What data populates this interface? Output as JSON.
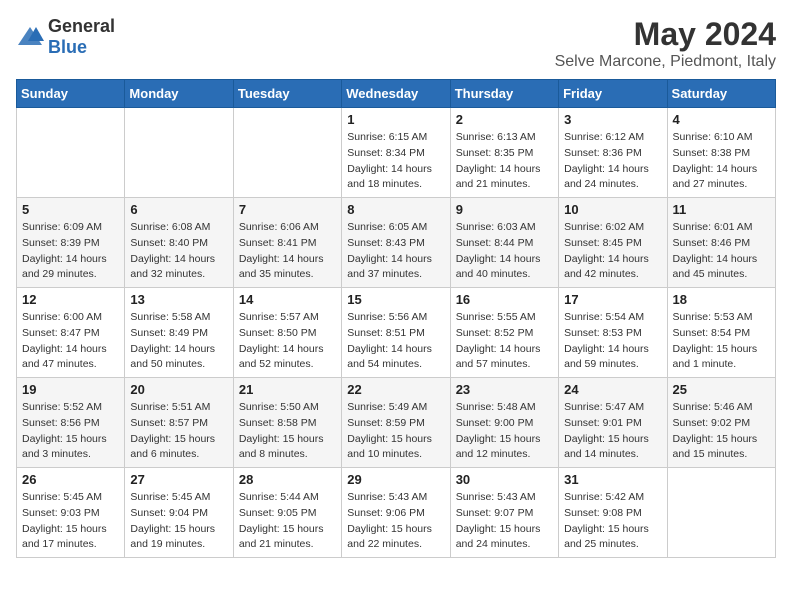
{
  "header": {
    "logo_general": "General",
    "logo_blue": "Blue",
    "month_title": "May 2024",
    "subtitle": "Selve Marcone, Piedmont, Italy"
  },
  "weekdays": [
    "Sunday",
    "Monday",
    "Tuesday",
    "Wednesday",
    "Thursday",
    "Friday",
    "Saturday"
  ],
  "weeks": [
    [
      {
        "day": "",
        "sunrise": "",
        "sunset": "",
        "daylight": ""
      },
      {
        "day": "",
        "sunrise": "",
        "sunset": "",
        "daylight": ""
      },
      {
        "day": "",
        "sunrise": "",
        "sunset": "",
        "daylight": ""
      },
      {
        "day": "1",
        "sunrise": "Sunrise: 6:15 AM",
        "sunset": "Sunset: 8:34 PM",
        "daylight": "Daylight: 14 hours and 18 minutes."
      },
      {
        "day": "2",
        "sunrise": "Sunrise: 6:13 AM",
        "sunset": "Sunset: 8:35 PM",
        "daylight": "Daylight: 14 hours and 21 minutes."
      },
      {
        "day": "3",
        "sunrise": "Sunrise: 6:12 AM",
        "sunset": "Sunset: 8:36 PM",
        "daylight": "Daylight: 14 hours and 24 minutes."
      },
      {
        "day": "4",
        "sunrise": "Sunrise: 6:10 AM",
        "sunset": "Sunset: 8:38 PM",
        "daylight": "Daylight: 14 hours and 27 minutes."
      }
    ],
    [
      {
        "day": "5",
        "sunrise": "Sunrise: 6:09 AM",
        "sunset": "Sunset: 8:39 PM",
        "daylight": "Daylight: 14 hours and 29 minutes."
      },
      {
        "day": "6",
        "sunrise": "Sunrise: 6:08 AM",
        "sunset": "Sunset: 8:40 PM",
        "daylight": "Daylight: 14 hours and 32 minutes."
      },
      {
        "day": "7",
        "sunrise": "Sunrise: 6:06 AM",
        "sunset": "Sunset: 8:41 PM",
        "daylight": "Daylight: 14 hours and 35 minutes."
      },
      {
        "day": "8",
        "sunrise": "Sunrise: 6:05 AM",
        "sunset": "Sunset: 8:43 PM",
        "daylight": "Daylight: 14 hours and 37 minutes."
      },
      {
        "day": "9",
        "sunrise": "Sunrise: 6:03 AM",
        "sunset": "Sunset: 8:44 PM",
        "daylight": "Daylight: 14 hours and 40 minutes."
      },
      {
        "day": "10",
        "sunrise": "Sunrise: 6:02 AM",
        "sunset": "Sunset: 8:45 PM",
        "daylight": "Daylight: 14 hours and 42 minutes."
      },
      {
        "day": "11",
        "sunrise": "Sunrise: 6:01 AM",
        "sunset": "Sunset: 8:46 PM",
        "daylight": "Daylight: 14 hours and 45 minutes."
      }
    ],
    [
      {
        "day": "12",
        "sunrise": "Sunrise: 6:00 AM",
        "sunset": "Sunset: 8:47 PM",
        "daylight": "Daylight: 14 hours and 47 minutes."
      },
      {
        "day": "13",
        "sunrise": "Sunrise: 5:58 AM",
        "sunset": "Sunset: 8:49 PM",
        "daylight": "Daylight: 14 hours and 50 minutes."
      },
      {
        "day": "14",
        "sunrise": "Sunrise: 5:57 AM",
        "sunset": "Sunset: 8:50 PM",
        "daylight": "Daylight: 14 hours and 52 minutes."
      },
      {
        "day": "15",
        "sunrise": "Sunrise: 5:56 AM",
        "sunset": "Sunset: 8:51 PM",
        "daylight": "Daylight: 14 hours and 54 minutes."
      },
      {
        "day": "16",
        "sunrise": "Sunrise: 5:55 AM",
        "sunset": "Sunset: 8:52 PM",
        "daylight": "Daylight: 14 hours and 57 minutes."
      },
      {
        "day": "17",
        "sunrise": "Sunrise: 5:54 AM",
        "sunset": "Sunset: 8:53 PM",
        "daylight": "Daylight: 14 hours and 59 minutes."
      },
      {
        "day": "18",
        "sunrise": "Sunrise: 5:53 AM",
        "sunset": "Sunset: 8:54 PM",
        "daylight": "Daylight: 15 hours and 1 minute."
      }
    ],
    [
      {
        "day": "19",
        "sunrise": "Sunrise: 5:52 AM",
        "sunset": "Sunset: 8:56 PM",
        "daylight": "Daylight: 15 hours and 3 minutes."
      },
      {
        "day": "20",
        "sunrise": "Sunrise: 5:51 AM",
        "sunset": "Sunset: 8:57 PM",
        "daylight": "Daylight: 15 hours and 6 minutes."
      },
      {
        "day": "21",
        "sunrise": "Sunrise: 5:50 AM",
        "sunset": "Sunset: 8:58 PM",
        "daylight": "Daylight: 15 hours and 8 minutes."
      },
      {
        "day": "22",
        "sunrise": "Sunrise: 5:49 AM",
        "sunset": "Sunset: 8:59 PM",
        "daylight": "Daylight: 15 hours and 10 minutes."
      },
      {
        "day": "23",
        "sunrise": "Sunrise: 5:48 AM",
        "sunset": "Sunset: 9:00 PM",
        "daylight": "Daylight: 15 hours and 12 minutes."
      },
      {
        "day": "24",
        "sunrise": "Sunrise: 5:47 AM",
        "sunset": "Sunset: 9:01 PM",
        "daylight": "Daylight: 15 hours and 14 minutes."
      },
      {
        "day": "25",
        "sunrise": "Sunrise: 5:46 AM",
        "sunset": "Sunset: 9:02 PM",
        "daylight": "Daylight: 15 hours and 15 minutes."
      }
    ],
    [
      {
        "day": "26",
        "sunrise": "Sunrise: 5:45 AM",
        "sunset": "Sunset: 9:03 PM",
        "daylight": "Daylight: 15 hours and 17 minutes."
      },
      {
        "day": "27",
        "sunrise": "Sunrise: 5:45 AM",
        "sunset": "Sunset: 9:04 PM",
        "daylight": "Daylight: 15 hours and 19 minutes."
      },
      {
        "day": "28",
        "sunrise": "Sunrise: 5:44 AM",
        "sunset": "Sunset: 9:05 PM",
        "daylight": "Daylight: 15 hours and 21 minutes."
      },
      {
        "day": "29",
        "sunrise": "Sunrise: 5:43 AM",
        "sunset": "Sunset: 9:06 PM",
        "daylight": "Daylight: 15 hours and 22 minutes."
      },
      {
        "day": "30",
        "sunrise": "Sunrise: 5:43 AM",
        "sunset": "Sunset: 9:07 PM",
        "daylight": "Daylight: 15 hours and 24 minutes."
      },
      {
        "day": "31",
        "sunrise": "Sunrise: 5:42 AM",
        "sunset": "Sunset: 9:08 PM",
        "daylight": "Daylight: 15 hours and 25 minutes."
      },
      {
        "day": "",
        "sunrise": "",
        "sunset": "",
        "daylight": ""
      }
    ]
  ]
}
